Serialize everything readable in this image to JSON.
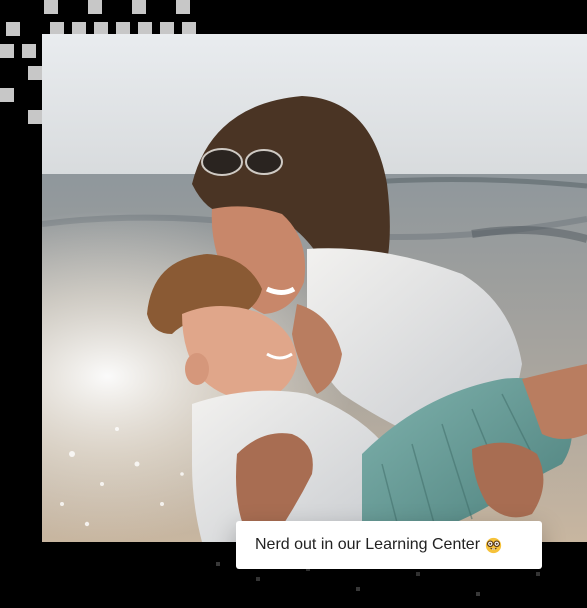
{
  "caption": {
    "text": "Nerd out in our Learning Center",
    "emoji": "nerd-face-emoji"
  },
  "photo": {
    "subject": "mother-and-child-beach-photo"
  },
  "colors": {
    "background": "#000000",
    "pattern": "#c7c7c7",
    "card": "#ffffff",
    "caption_text": "#222222"
  }
}
